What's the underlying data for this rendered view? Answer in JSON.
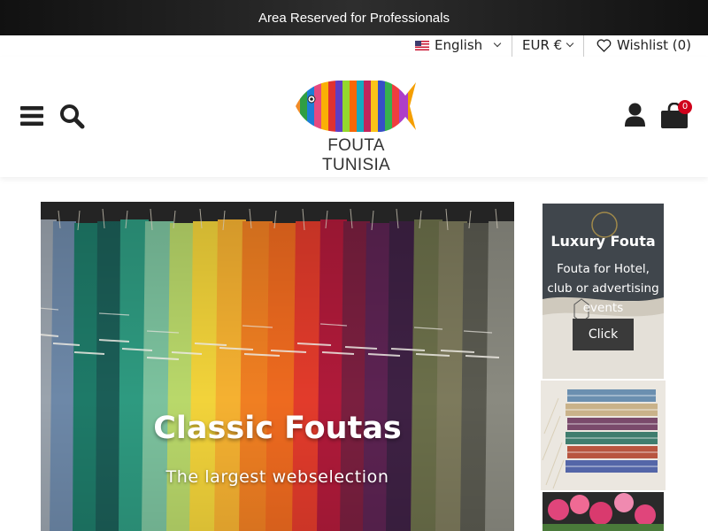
{
  "topbar": {
    "text": "Area Reserved for Professionals"
  },
  "utility": {
    "language": "English",
    "currency": "EUR €",
    "wishlist": "Wishlist (0)"
  },
  "header": {
    "logo_text": "FOUTA TUNISIA",
    "cart_count": "0"
  },
  "hero": {
    "title": "Classic Foutas",
    "subtitle": "The largest webselection"
  },
  "side_banners": [
    {
      "title": "Luxury Fouta",
      "description": "Fouta for Hotel, club or advertising events",
      "button": "Click"
    }
  ],
  "colors": {
    "topbar_bg": "#1a1a1a",
    "cart_badge": "#d0021b",
    "button_bg": "#3a3a3a"
  }
}
